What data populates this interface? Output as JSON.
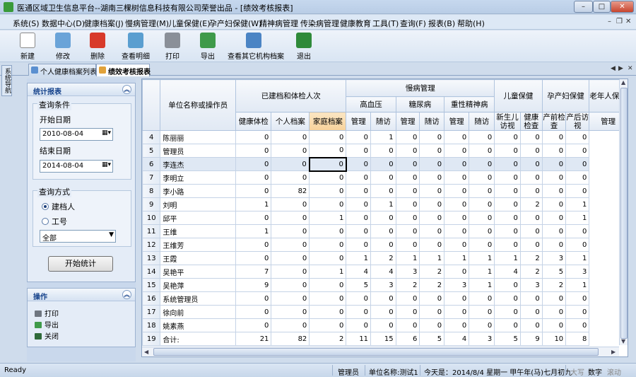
{
  "window": {
    "title": "医通区域卫生信息平台--湖南三棵树信息科技有限公司荣誉出品 - [绩效考核报表]",
    "minimize": "–",
    "maximize": "□",
    "close": "✕"
  },
  "menu": [
    {
      "label": "系统(S)"
    },
    {
      "label": "数据中心(D)"
    },
    {
      "label": "健康档案(J)"
    },
    {
      "label": "慢病管理(M)"
    },
    {
      "label": "儿童保健(E)"
    },
    {
      "label": "孕产妇保健(W)"
    },
    {
      "label": "精神病管理"
    },
    {
      "label": "传染病管理"
    },
    {
      "label": "健康教育"
    },
    {
      "label": "工具(T)"
    },
    {
      "label": "查询(F)"
    },
    {
      "label": "报表(B)"
    },
    {
      "label": "帮助(H)"
    }
  ],
  "menu_controls": {
    "min": "–",
    "restore": "❐",
    "close": "✕"
  },
  "toolbar": [
    {
      "label": "新建",
      "icon": "new-document-icon",
      "color": "#ffffff"
    },
    {
      "label": "修改",
      "icon": "edit-icon",
      "color": "#6aa3d8"
    },
    {
      "label": "删除",
      "icon": "delete-icon",
      "color": "#d83a2a"
    },
    {
      "label": "查看明细",
      "icon": "view-details-icon",
      "color": "#5a9ed0"
    },
    {
      "label": "打印",
      "icon": "print-icon",
      "color": "#8a8f98"
    },
    {
      "label": "导出",
      "icon": "export-icon",
      "color": "#3f9a4a"
    },
    {
      "label": "查看其它机构档案",
      "icon": "search-records-icon",
      "color": "#4b84c4"
    },
    {
      "label": "退出",
      "icon": "exit-icon",
      "color": "#2f8a3a"
    }
  ],
  "tabs": [
    {
      "label": "个人健康档案列表",
      "active": false
    },
    {
      "label": "绩效考核报表",
      "active": true
    }
  ],
  "tab_nav": {
    "prev": "◀",
    "next": "▶",
    "close": "✕"
  },
  "side_tab": "系统导航",
  "stats_panel": {
    "title": "统计报表",
    "collapse": "︽",
    "conditions_title": "查询条件",
    "start_label": "开始日期",
    "start_value": "2010-08-04",
    "end_label": "结束日期",
    "end_value": "2014-08-04",
    "method_title": "查询方式",
    "radio_archiver": "建档人",
    "radio_staffno": "工号",
    "scope_value": "全部",
    "start_button": "开始统计"
  },
  "ops_panel": {
    "title": "操作",
    "collapse": "︽",
    "items": [
      {
        "label": "打印",
        "icon": "print-icon",
        "color": "#6f7680"
      },
      {
        "label": "导出",
        "icon": "export-icon",
        "color": "#3f9a4a"
      },
      {
        "label": "关闭",
        "icon": "close-icon",
        "color": "#2f6a3a"
      }
    ]
  },
  "grid": {
    "h_unit": "单位名称或操作员",
    "h_archive": "已建档和体检人次",
    "h_chronic": "慢病管理",
    "h_child": "儿童保健",
    "h_maternal": "孕产妇保健",
    "h_elderly": "老年人保健",
    "h_htn": "高血压",
    "h_dm": "糖尿病",
    "h_psy": "重性精神病",
    "h_exam": "健康体检",
    "h_personal": "个人档案",
    "h_family": "家庭档案",
    "h_mgmt": "管理",
    "h_visit": "随访",
    "h_newborn": "新生儿访视",
    "h_healthcheck": "健康检查",
    "h_prenatal": "产前检查",
    "h_postnatal": "产后访视",
    "rows": [
      {
        "no": "4",
        "name": "陈丽丽",
        "v": [
          "0",
          "0",
          "0",
          "0",
          "1",
          "0",
          "0",
          "0",
          "0",
          "0",
          "0",
          "0",
          "0"
        ]
      },
      {
        "no": "5",
        "name": "管理员",
        "v": [
          "0",
          "0",
          "0",
          "0",
          "0",
          "0",
          "0",
          "0",
          "0",
          "0",
          "0",
          "0",
          "0"
        ]
      },
      {
        "no": "6",
        "name": "李连杰",
        "v": [
          "0",
          "0",
          "0",
          "0",
          "0",
          "0",
          "0",
          "0",
          "0",
          "0",
          "0",
          "0",
          "0"
        ]
      },
      {
        "no": "7",
        "name": "李明立",
        "v": [
          "0",
          "0",
          "0",
          "0",
          "0",
          "0",
          "0",
          "0",
          "0",
          "0",
          "0",
          "0",
          "0"
        ]
      },
      {
        "no": "8",
        "name": "李小路",
        "v": [
          "0",
          "82",
          "0",
          "0",
          "0",
          "0",
          "0",
          "0",
          "0",
          "0",
          "0",
          "0",
          "0"
        ]
      },
      {
        "no": "9",
        "name": "刘明",
        "v": [
          "1",
          "0",
          "0",
          "0",
          "1",
          "0",
          "0",
          "0",
          "0",
          "0",
          "2",
          "0",
          "1"
        ]
      },
      {
        "no": "10",
        "name": "邱平",
        "v": [
          "0",
          "0",
          "1",
          "0",
          "0",
          "0",
          "0",
          "0",
          "0",
          "0",
          "0",
          "0",
          "1"
        ]
      },
      {
        "no": "11",
        "name": "王维",
        "v": [
          "1",
          "0",
          "0",
          "0",
          "0",
          "0",
          "0",
          "0",
          "0",
          "0",
          "0",
          "0",
          "0"
        ]
      },
      {
        "no": "12",
        "name": "王维芳",
        "v": [
          "0",
          "0",
          "0",
          "0",
          "0",
          "0",
          "0",
          "0",
          "0",
          "0",
          "0",
          "0",
          "0"
        ]
      },
      {
        "no": "13",
        "name": "王霞",
        "v": [
          "0",
          "0",
          "0",
          "1",
          "2",
          "1",
          "1",
          "1",
          "1",
          "1",
          "2",
          "3",
          "1"
        ]
      },
      {
        "no": "14",
        "name": "吴艳平",
        "v": [
          "7",
          "0",
          "1",
          "4",
          "4",
          "3",
          "2",
          "0",
          "1",
          "4",
          "2",
          "5",
          "3"
        ]
      },
      {
        "no": "15",
        "name": "吴艳萍",
        "v": [
          "9",
          "0",
          "0",
          "5",
          "3",
          "2",
          "2",
          "3",
          "1",
          "0",
          "3",
          "2",
          "1"
        ]
      },
      {
        "no": "16",
        "name": "系统管理员",
        "v": [
          "0",
          "0",
          "0",
          "0",
          "0",
          "0",
          "0",
          "0",
          "0",
          "0",
          "0",
          "0",
          "0"
        ]
      },
      {
        "no": "17",
        "name": "徐向前",
        "v": [
          "0",
          "0",
          "0",
          "0",
          "0",
          "0",
          "0",
          "0",
          "0",
          "0",
          "0",
          "0",
          "0"
        ]
      },
      {
        "no": "18",
        "name": "姚素燕",
        "v": [
          "0",
          "0",
          "0",
          "0",
          "0",
          "0",
          "0",
          "0",
          "0",
          "0",
          "0",
          "0",
          "0"
        ]
      },
      {
        "no": "19",
        "name": "合计:",
        "v": [
          "21",
          "82",
          "2",
          "11",
          "15",
          "6",
          "5",
          "4",
          "3",
          "5",
          "9",
          "10",
          "8"
        ]
      }
    ]
  },
  "scroll_glyphs": {
    "up": "▲",
    "down": "▼",
    "left": "◀",
    "right": "▶"
  },
  "status": {
    "ready": "Ready",
    "user": "管理员",
    "unit": "单位名称:测试1",
    "today": "今天是：2014/8/4 星期一 甲午年(马)七月初九",
    "caps": "大写",
    "num": "数字",
    "scroll": "滚动"
  }
}
